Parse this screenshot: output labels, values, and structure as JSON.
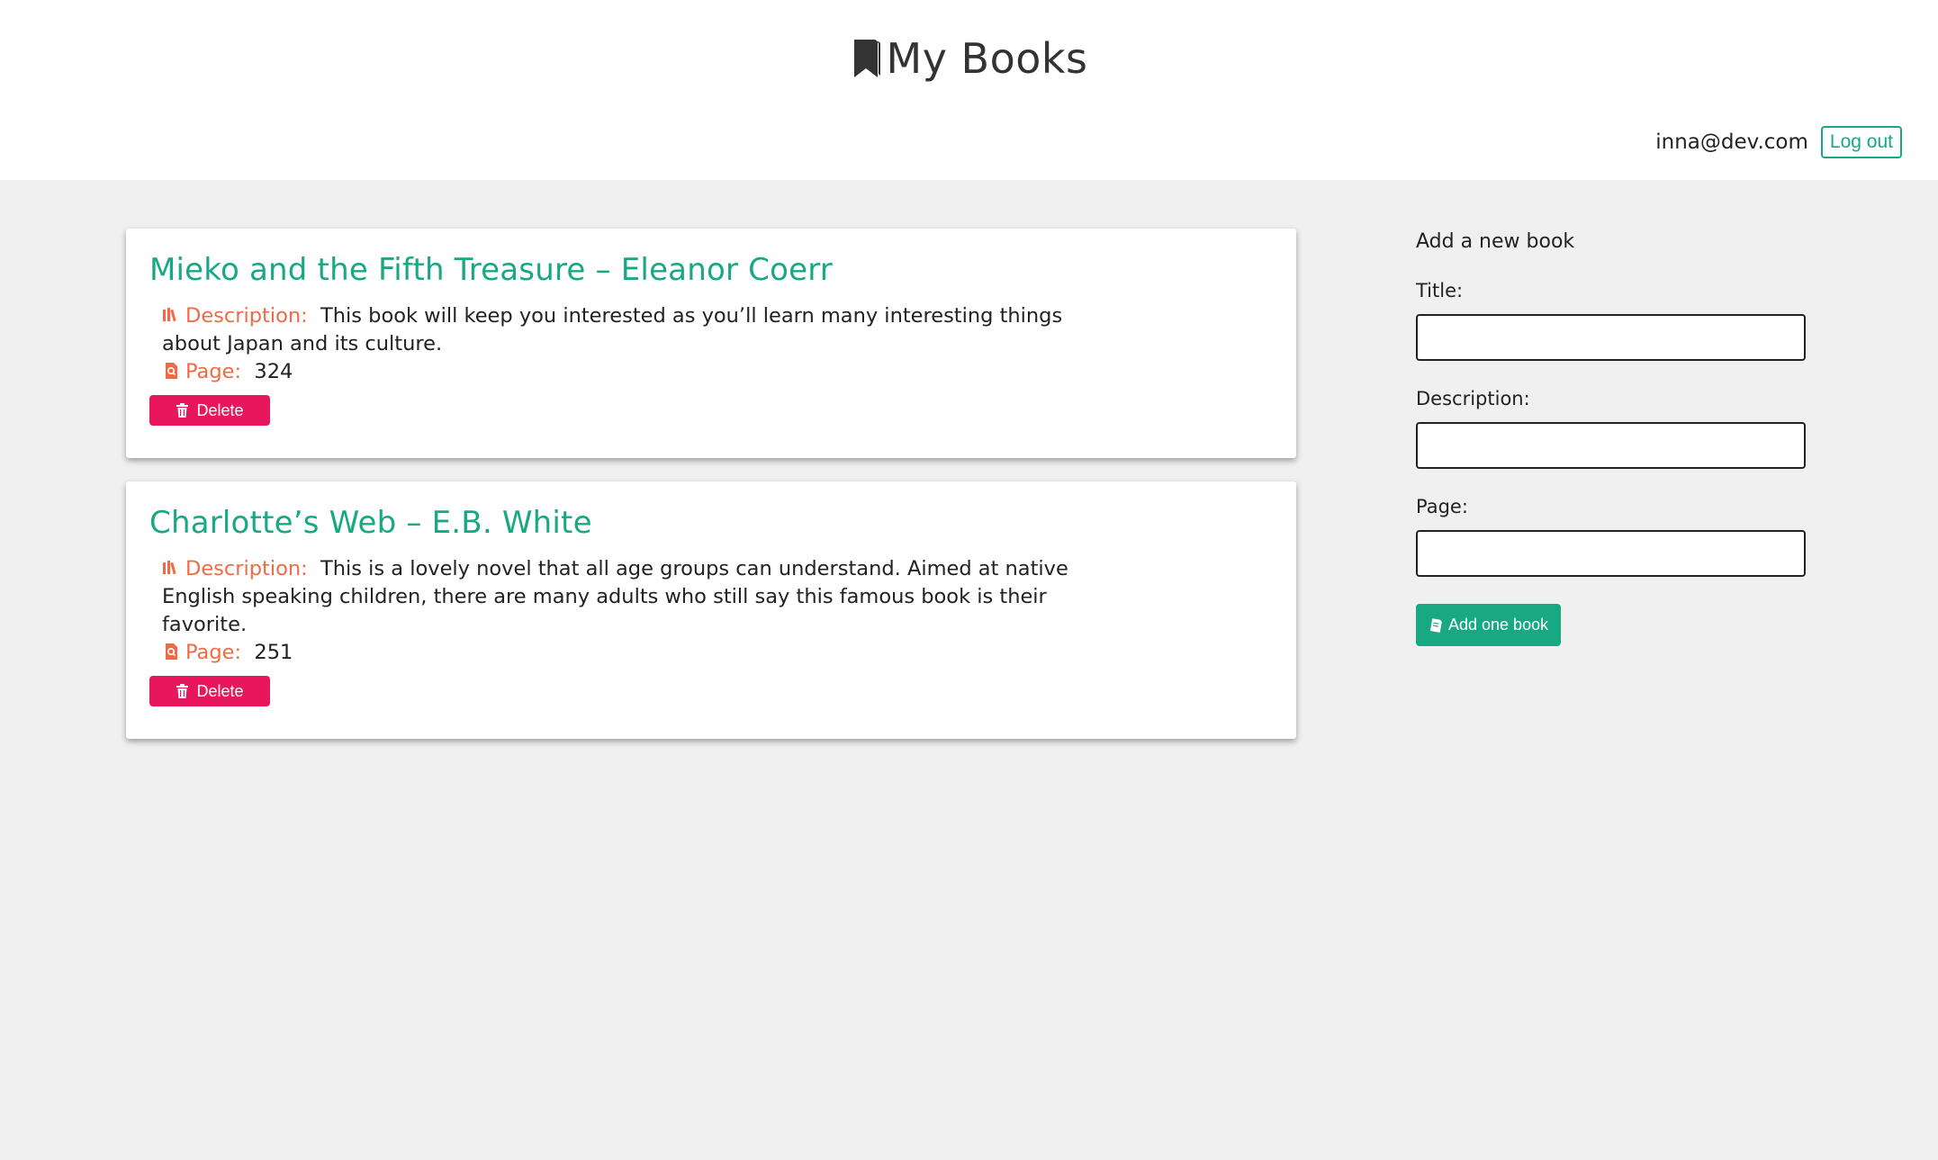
{
  "header": {
    "title": "My Books",
    "logo_icon": "bookmark-icon",
    "user_email": "inna@dev.com",
    "logout_label": "Log out"
  },
  "books": [
    {
      "title": "Mieko and the Fifth Treasure – Eleanor Coerr",
      "description_label": "Description:",
      "description": "This book will keep you interested as you’ll learn many interesting things about Japan and its culture.",
      "page_label": "Page:",
      "page": "324",
      "delete_label": "Delete"
    },
    {
      "title": "Charlotte’s Web – E.B. White",
      "description_label": "Description:",
      "description": "This is a lovely novel that all age groups can understand. Aimed at native English speaking children, there are many adults who still say this famous book is their favorite.",
      "page_label": "Page:",
      "page": "251",
      "delete_label": "Delete"
    }
  ],
  "form": {
    "heading": "Add a new book",
    "title_label": "Title:",
    "title_value": "",
    "description_label": "Description:",
    "description_value": "",
    "page_label": "Page:",
    "page_value": "",
    "submit_label": "Add one book"
  },
  "colors": {
    "accent": "#18a883",
    "label": "#f06b45",
    "danger": "#e8165c",
    "background": "#f0f0f0"
  },
  "icons": {
    "description": "books-icon",
    "page": "page-search-icon",
    "delete": "trash-icon",
    "add": "book-add-icon"
  }
}
